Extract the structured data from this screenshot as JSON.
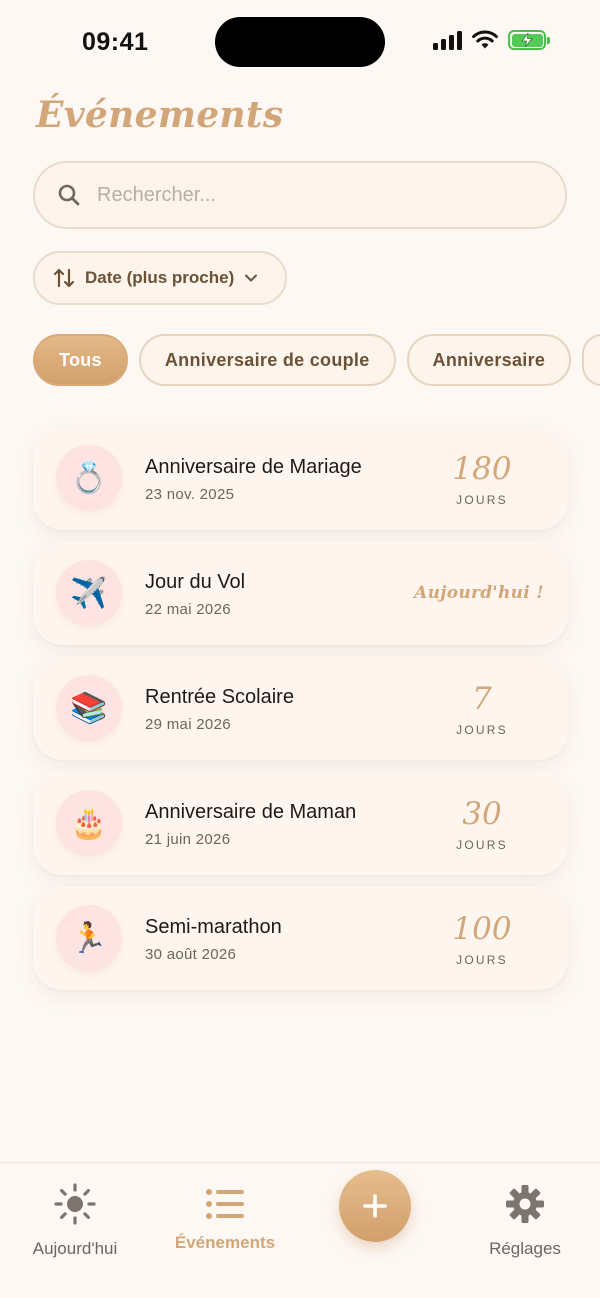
{
  "status_bar": {
    "time": "09:41"
  },
  "page": {
    "title": "Événements"
  },
  "search": {
    "placeholder": "Rechercher...",
    "value": ""
  },
  "sort": {
    "label": "Date (plus proche)"
  },
  "filters": [
    {
      "label": "Tous",
      "active": true
    },
    {
      "label": "Anniversaire de couple",
      "active": false
    },
    {
      "label": "Anniversaire",
      "active": false
    }
  ],
  "events": [
    {
      "emoji": "💍",
      "icon": "ring-icon",
      "title": "Anniversaire de Mariage",
      "date": "23 nov. 2025",
      "count": "180",
      "unit": "JOURS"
    },
    {
      "emoji": "✈️",
      "icon": "airplane-icon",
      "title": "Jour du Vol",
      "date": "22 mai 2026",
      "today": "Aujourd'hui !"
    },
    {
      "emoji": "📚",
      "icon": "books-icon",
      "title": "Rentrée Scolaire",
      "date": "29 mai 2026",
      "count": "7",
      "unit": "JOURS"
    },
    {
      "emoji": "🎂",
      "icon": "cake-icon",
      "title": "Anniversaire de Maman",
      "date": "21 juin 2026",
      "count": "30",
      "unit": "JOURS"
    },
    {
      "emoji": "🏃",
      "icon": "runner-icon",
      "title": "Semi-marathon",
      "date": "30 août 2026",
      "count": "100",
      "unit": "JOURS"
    }
  ],
  "nav": {
    "today_label": "Aujourd'hui",
    "events_label": "Événements",
    "settings_label": "Réglages"
  },
  "colors": {
    "accent": "#d2a679",
    "background": "#fdf8f4",
    "icon_circle": "#fde3e1"
  }
}
